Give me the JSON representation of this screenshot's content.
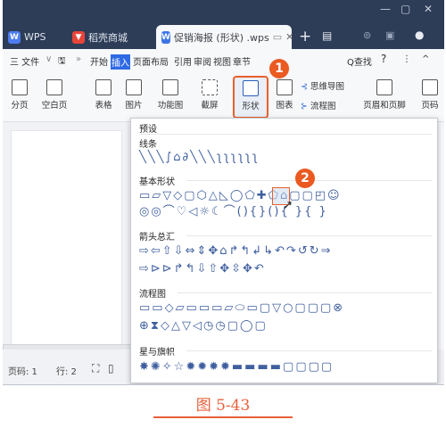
{
  "titlebar": {
    "tabs": [
      {
        "label": "WPS",
        "icon": "wps-logo-icon"
      },
      {
        "label": "稻壳商城",
        "icon": "docer-icon"
      },
      {
        "label": "促销海报 (形状) .wps",
        "icon": "writer-doc-icon"
      }
    ],
    "new_tab": "+",
    "window_controls": {
      "minimize": "—",
      "restore": "▢",
      "close": "✕"
    }
  },
  "menubar": {
    "app_menu": "三 文件",
    "items": [
      "开始",
      "插入",
      "页面布局",
      "引用",
      "审阅",
      "视图",
      "章节"
    ],
    "active_item": "插入",
    "search": "Q查找",
    "help": "?",
    "more": "⋮",
    "collapse": "^"
  },
  "ribbon": {
    "buttons": [
      "分页",
      "空白页",
      "表格",
      "图片",
      "功能图",
      "截屏",
      "形状",
      "图表",
      "页眉和页脚",
      "页码"
    ],
    "small_buttons": [
      "思维导图",
      "流程图"
    ],
    "highlighted": "形状"
  },
  "shapes_dropdown": {
    "header": "预设",
    "sections": [
      {
        "name": "线条",
        "rows": [
          "╲╲╲∫⌂∂╲╲╲ʅʅʅʅʅʅ"
        ]
      },
      {
        "name": "基本形状",
        "rows": [
          "▭▱▽◇▢⬡△◺◯⬠✚⬠⌂▢▢◰☺",
          "◎◎⌒♡◁☼☾⌒(){}(){ }{ }"
        ]
      },
      {
        "name": "箭头总汇",
        "rows": [
          "⇨⇦⇧⇩⇔⇕✥⌂↱↰↲↳↶↷↺↻⇒",
          "⇨⊳⊳↱↰⇩⇧✥⇳✥↶"
        ]
      },
      {
        "name": "流程图",
        "rows": [
          "▭▭◇▱▭▭▭▱⬭▭▢▽○▢▢▢⊗",
          "⊕⧗◇△▽◁◷◷▢◯▢"
        ]
      },
      {
        "name": "星与旗帜",
        "rows": [
          "✸✺✧☆✹✹✹✹▬▬▬▬▢▢▢▢"
        ]
      }
    ]
  },
  "annotations": [
    "1",
    "2"
  ],
  "statusbar": {
    "page": "页码: 1",
    "line": "行: 2"
  },
  "caption": "图 5-43",
  "colors": {
    "titlebar_bg": "#2d3c57",
    "accent_blue": "#2f6ae5",
    "highlight_orange": "#e8602c",
    "caption_red": "#e8603c"
  }
}
